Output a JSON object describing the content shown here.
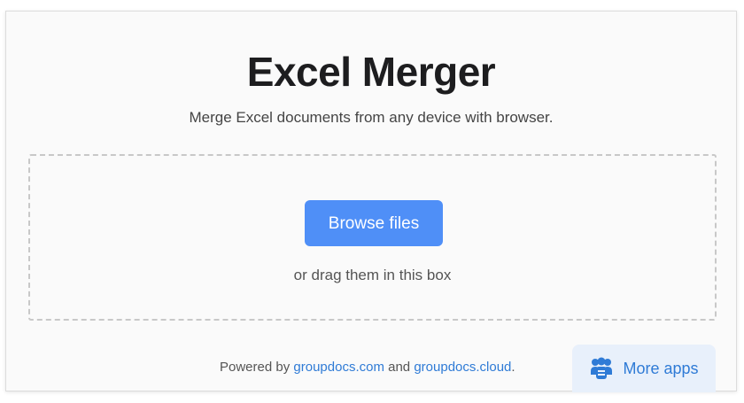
{
  "page": {
    "title": "Excel Merger",
    "subtitle": "Merge Excel documents from any device with browser."
  },
  "dropzone": {
    "browse_label": "Browse files",
    "drag_hint": "or drag them in this box"
  },
  "footer": {
    "powered_by": "Powered by ",
    "link1": "groupdocs.com",
    "and": " and ",
    "link2": "groupdocs.cloud",
    "period": "."
  },
  "more_apps": {
    "label": "More apps",
    "icon": "apps-group-icon"
  },
  "colors": {
    "accent": "#4f8ff7",
    "link": "#2f7bd6"
  }
}
